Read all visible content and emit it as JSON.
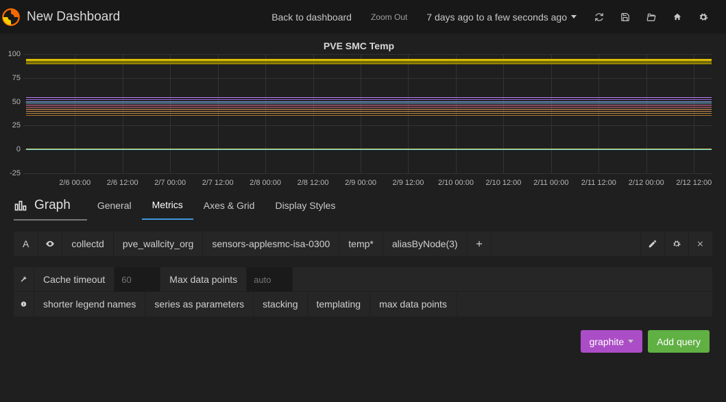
{
  "header": {
    "title": "New Dashboard",
    "back": "Back to dashboard",
    "zoom": "Zoom Out",
    "time": "7 days ago to a few seconds ago"
  },
  "chart_data": {
    "type": "line",
    "title": "PVE SMC Temp",
    "ylim": [
      -25,
      100
    ],
    "yticks": [
      -25,
      0,
      25,
      50,
      75,
      100
    ],
    "xticks": [
      "2/6 00:00",
      "2/6 12:00",
      "2/7 00:00",
      "2/7 12:00",
      "2/8 00:00",
      "2/8 12:00",
      "2/9 00:00",
      "2/9 12:00",
      "2/10 00:00",
      "2/10 12:00",
      "2/11 00:00",
      "2/11 12:00",
      "2/12 00:00",
      "2/12 12:00"
    ],
    "top_band": {
      "min": 90,
      "max": 95,
      "count": 7
    },
    "mid_band": {
      "min": 36,
      "max": 55,
      "count": 10
    },
    "low_lines": [
      0,
      1
    ],
    "note": "Many dense overlapping series; values are approximate ranges read from the plot."
  },
  "tabs": {
    "panel_type": "Graph",
    "items": [
      "General",
      "Metrics",
      "Axes & Grid",
      "Display Styles"
    ],
    "active": 1
  },
  "query": {
    "letter": "A",
    "segments": [
      "collectd",
      "pve_wallcity_org",
      "sensors-applesmc-isa-0300",
      "temp*",
      "aliasByNode(3)"
    ]
  },
  "options": {
    "cache_timeout_label": "Cache timeout",
    "cache_timeout_placeholder": "60",
    "max_datapoints_label": "Max data points",
    "max_datapoints_placeholder": "auto",
    "tips": [
      "shorter legend names",
      "series as parameters",
      "stacking",
      "templating",
      "max data points"
    ]
  },
  "footer": {
    "datasource": "graphite",
    "add_query": "Add query"
  }
}
